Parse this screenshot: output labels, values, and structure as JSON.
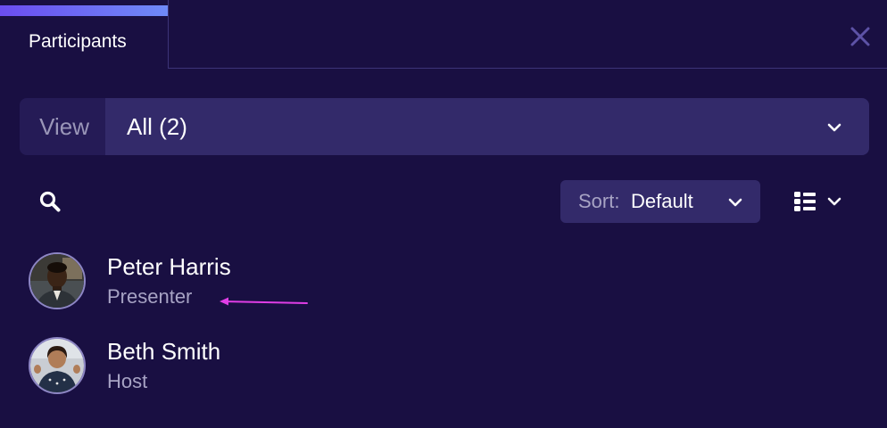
{
  "tabs": [
    {
      "label": "Participants",
      "active": true
    }
  ],
  "view": {
    "label": "View",
    "value": "All (2)"
  },
  "sort": {
    "label": "Sort:",
    "value": "Default"
  },
  "participants": [
    {
      "name": "Peter Harris",
      "role": "Presenter"
    },
    {
      "name": "Beth Smith",
      "role": "Host"
    }
  ],
  "icons": {
    "close": "close-icon",
    "search": "search-icon",
    "view_chevron": "chevron-down-icon",
    "sort_chevron": "chevron-down-icon",
    "layout": "list-layout-icon"
  },
  "colors": {
    "background": "#190f42",
    "control_bg": "#332a6a",
    "tab_accent_start": "#6b4df0",
    "tab_accent_end": "#6f8af8",
    "annotation_arrow": "#e03ee6"
  }
}
